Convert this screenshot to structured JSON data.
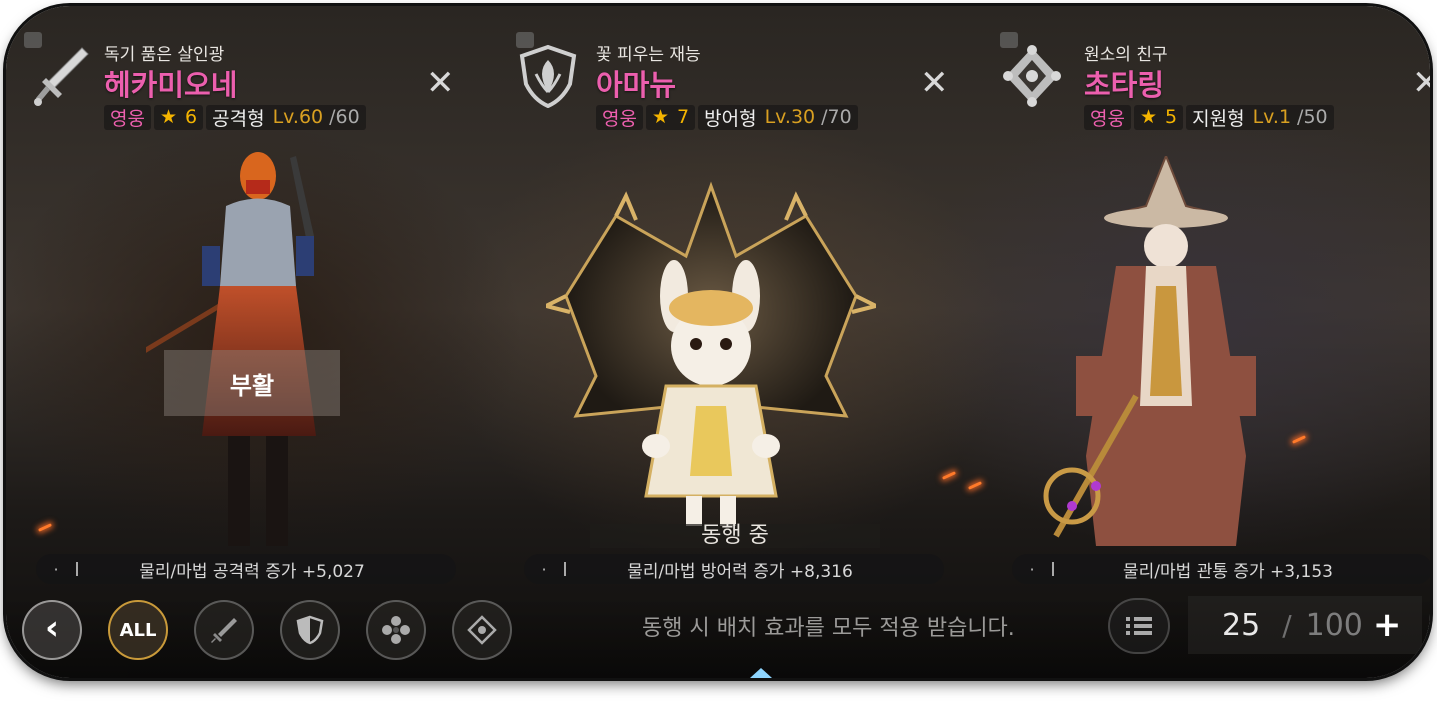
{
  "characters": [
    {
      "subtitle": "독기 품은 살인광",
      "name": "헤카미오네",
      "rarity": "영웅",
      "stars": "6",
      "role": "공격형",
      "level": "Lv.60",
      "max_level": "/60",
      "stat": "물리/마법 공격력 증가 +5,027",
      "class_icon": "sword-icon",
      "status_label": "부활"
    },
    {
      "subtitle": "꽃 피우는 재능",
      "name": "아마뉴",
      "rarity": "영웅",
      "stars": "7",
      "role": "방어형",
      "level": "Lv.30",
      "max_level": "/70",
      "stat": "물리/마법 방어력 증가 +8,316",
      "class_icon": "shield-leaf-icon",
      "status_label": "동행 중"
    },
    {
      "subtitle": "원소의 친구",
      "name": "초타링",
      "rarity": "영웅",
      "stars": "5",
      "role": "지원형",
      "level": "Lv.1",
      "max_level": "/50",
      "stat": "물리/마법 관통 증가 +3,153",
      "class_icon": "support-diamond-icon"
    }
  ],
  "bottom_bar": {
    "all_label": "ALL",
    "notice": "동행 시 배치 효과를 모두 적용 받습니다.",
    "count_current": "25",
    "count_sep": "/",
    "count_max": "100",
    "plus": "+"
  },
  "colors": {
    "name_pink": "#ec5fae",
    "star_gold": "#f4b400",
    "level_gold": "#d9a021"
  }
}
